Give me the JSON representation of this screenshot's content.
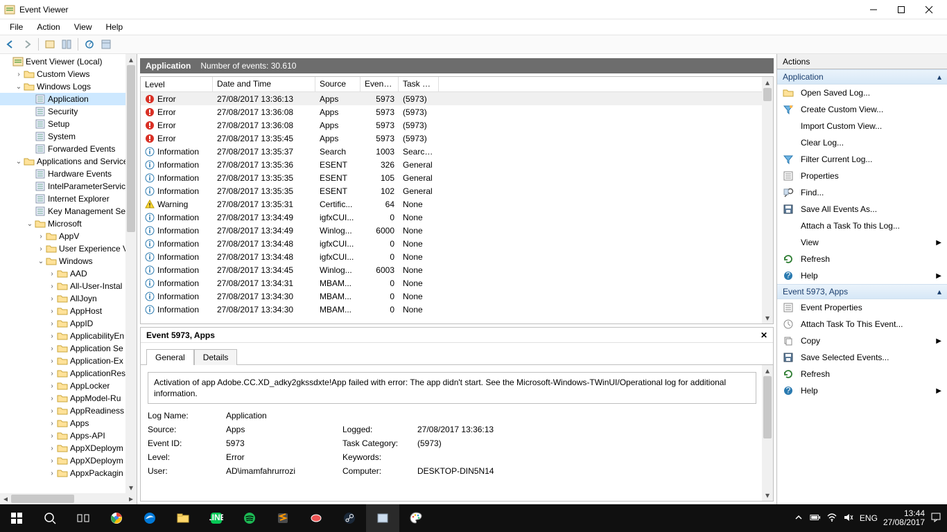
{
  "window": {
    "title": "Event Viewer"
  },
  "menu": [
    "File",
    "Action",
    "View",
    "Help"
  ],
  "tree": [
    {
      "depth": 0,
      "exp": "",
      "icon": "evv",
      "label": "Event Viewer (Local)",
      "sel": false
    },
    {
      "depth": 1,
      "exp": ">",
      "icon": "folder",
      "label": "Custom Views"
    },
    {
      "depth": 1,
      "exp": "v",
      "icon": "folder",
      "label": "Windows Logs"
    },
    {
      "depth": 2,
      "exp": "",
      "icon": "log",
      "label": "Application",
      "sel": true
    },
    {
      "depth": 2,
      "exp": "",
      "icon": "log",
      "label": "Security"
    },
    {
      "depth": 2,
      "exp": "",
      "icon": "log",
      "label": "Setup"
    },
    {
      "depth": 2,
      "exp": "",
      "icon": "log",
      "label": "System"
    },
    {
      "depth": 2,
      "exp": "",
      "icon": "log",
      "label": "Forwarded Events"
    },
    {
      "depth": 1,
      "exp": "v",
      "icon": "folder",
      "label": "Applications and Services"
    },
    {
      "depth": 2,
      "exp": "",
      "icon": "log",
      "label": "Hardware Events"
    },
    {
      "depth": 2,
      "exp": "",
      "icon": "log",
      "label": "IntelParameterService"
    },
    {
      "depth": 2,
      "exp": "",
      "icon": "log",
      "label": "Internet Explorer"
    },
    {
      "depth": 2,
      "exp": "",
      "icon": "log",
      "label": "Key Management Ser"
    },
    {
      "depth": 2,
      "exp": "v",
      "icon": "folder",
      "label": "Microsoft"
    },
    {
      "depth": 3,
      "exp": ">",
      "icon": "folder",
      "label": "AppV"
    },
    {
      "depth": 3,
      "exp": ">",
      "icon": "folder",
      "label": "User Experience Vi"
    },
    {
      "depth": 3,
      "exp": "v",
      "icon": "folder",
      "label": "Windows"
    },
    {
      "depth": 4,
      "exp": ">",
      "icon": "folder",
      "label": "AAD"
    },
    {
      "depth": 4,
      "exp": ">",
      "icon": "folder",
      "label": "All-User-Instal"
    },
    {
      "depth": 4,
      "exp": ">",
      "icon": "folder",
      "label": "AllJoyn"
    },
    {
      "depth": 4,
      "exp": ">",
      "icon": "folder",
      "label": "AppHost"
    },
    {
      "depth": 4,
      "exp": ">",
      "icon": "folder",
      "label": "AppID"
    },
    {
      "depth": 4,
      "exp": ">",
      "icon": "folder",
      "label": "ApplicabilityEn"
    },
    {
      "depth": 4,
      "exp": ">",
      "icon": "folder",
      "label": "Application Se"
    },
    {
      "depth": 4,
      "exp": ">",
      "icon": "folder",
      "label": "Application-Ex"
    },
    {
      "depth": 4,
      "exp": ">",
      "icon": "folder",
      "label": "ApplicationRes"
    },
    {
      "depth": 4,
      "exp": ">",
      "icon": "folder",
      "label": "AppLocker"
    },
    {
      "depth": 4,
      "exp": ">",
      "icon": "folder",
      "label": "AppModel-Ru"
    },
    {
      "depth": 4,
      "exp": ">",
      "icon": "folder",
      "label": "AppReadiness"
    },
    {
      "depth": 4,
      "exp": ">",
      "icon": "folder",
      "label": "Apps"
    },
    {
      "depth": 4,
      "exp": ">",
      "icon": "folder",
      "label": "Apps-API"
    },
    {
      "depth": 4,
      "exp": ">",
      "icon": "folder",
      "label": "AppXDeploym"
    },
    {
      "depth": 4,
      "exp": ">",
      "icon": "folder",
      "label": "AppXDeploym"
    },
    {
      "depth": 4,
      "exp": ">",
      "icon": "folder",
      "label": "AppxPackagin"
    }
  ],
  "center": {
    "head_label": "Application",
    "head_count": "Number of events: 30.610",
    "columns": [
      "Level",
      "Date and Time",
      "Source",
      "Event ID",
      "Task C..."
    ],
    "events": [
      {
        "lvl": "Error",
        "dt": "27/08/2017 13:36:13",
        "src": "Apps",
        "id": "5973",
        "tc": "(5973)",
        "sel": true
      },
      {
        "lvl": "Error",
        "dt": "27/08/2017 13:36:08",
        "src": "Apps",
        "id": "5973",
        "tc": "(5973)"
      },
      {
        "lvl": "Error",
        "dt": "27/08/2017 13:36:08",
        "src": "Apps",
        "id": "5973",
        "tc": "(5973)"
      },
      {
        "lvl": "Error",
        "dt": "27/08/2017 13:35:45",
        "src": "Apps",
        "id": "5973",
        "tc": "(5973)"
      },
      {
        "lvl": "Information",
        "dt": "27/08/2017 13:35:37",
        "src": "Search",
        "id": "1003",
        "tc": "Search ..."
      },
      {
        "lvl": "Information",
        "dt": "27/08/2017 13:35:36",
        "src": "ESENT",
        "id": "326",
        "tc": "General"
      },
      {
        "lvl": "Information",
        "dt": "27/08/2017 13:35:35",
        "src": "ESENT",
        "id": "105",
        "tc": "General"
      },
      {
        "lvl": "Information",
        "dt": "27/08/2017 13:35:35",
        "src": "ESENT",
        "id": "102",
        "tc": "General"
      },
      {
        "lvl": "Warning",
        "dt": "27/08/2017 13:35:31",
        "src": "Certific...",
        "id": "64",
        "tc": "None"
      },
      {
        "lvl": "Information",
        "dt": "27/08/2017 13:34:49",
        "src": "igfxCUI...",
        "id": "0",
        "tc": "None"
      },
      {
        "lvl": "Information",
        "dt": "27/08/2017 13:34:49",
        "src": "Winlog...",
        "id": "6000",
        "tc": "None"
      },
      {
        "lvl": "Information",
        "dt": "27/08/2017 13:34:48",
        "src": "igfxCUI...",
        "id": "0",
        "tc": "None"
      },
      {
        "lvl": "Information",
        "dt": "27/08/2017 13:34:48",
        "src": "igfxCUI...",
        "id": "0",
        "tc": "None"
      },
      {
        "lvl": "Information",
        "dt": "27/08/2017 13:34:45",
        "src": "Winlog...",
        "id": "6003",
        "tc": "None"
      },
      {
        "lvl": "Information",
        "dt": "27/08/2017 13:34:31",
        "src": "MBAM...",
        "id": "0",
        "tc": "None"
      },
      {
        "lvl": "Information",
        "dt": "27/08/2017 13:34:30",
        "src": "MBAM...",
        "id": "0",
        "tc": "None"
      },
      {
        "lvl": "Information",
        "dt": "27/08/2017 13:34:30",
        "src": "MBAM...",
        "id": "0",
        "tc": "None"
      }
    ],
    "details": {
      "title": "Event 5973, Apps",
      "tabs": [
        "General",
        "Details"
      ],
      "message": "Activation of app Adobe.CC.XD_adky2gkssdxte!App failed with error: The app didn't start. See the Microsoft-Windows-TWinUI/Operational log for additional information.",
      "fields": {
        "logname_k": "Log Name:",
        "logname_v": "Application",
        "source_k": "Source:",
        "source_v": "Apps",
        "logged_k": "Logged:",
        "logged_v": "27/08/2017 13:36:13",
        "eventid_k": "Event ID:",
        "eventid_v": "5973",
        "taskcat_k": "Task Category:",
        "taskcat_v": "(5973)",
        "level_k": "Level:",
        "level_v": "Error",
        "keywords_k": "Keywords:",
        "keywords_v": "",
        "user_k": "User:",
        "user_v": "AD\\imamfahrurrozi",
        "computer_k": "Computer:",
        "computer_v": "DESKTOP-DIN5N14"
      }
    }
  },
  "actions": {
    "title": "Actions",
    "section1": "Application",
    "items1": [
      {
        "icon": "open",
        "label": "Open Saved Log..."
      },
      {
        "icon": "filter-new",
        "label": "Create Custom View..."
      },
      {
        "icon": "none",
        "label": "Import Custom View..."
      },
      {
        "icon": "none",
        "label": "Clear Log..."
      },
      {
        "icon": "filter",
        "label": "Filter Current Log..."
      },
      {
        "icon": "props",
        "label": "Properties"
      },
      {
        "icon": "find",
        "label": "Find..."
      },
      {
        "icon": "save",
        "label": "Save All Events As..."
      },
      {
        "icon": "none",
        "label": "Attach a Task To this Log..."
      },
      {
        "icon": "none",
        "label": "View",
        "sub": true
      },
      {
        "icon": "refresh",
        "label": "Refresh"
      },
      {
        "icon": "help",
        "label": "Help",
        "sub": true
      }
    ],
    "section2": "Event 5973, Apps",
    "items2": [
      {
        "icon": "props",
        "label": "Event Properties"
      },
      {
        "icon": "task",
        "label": "Attach Task To This Event..."
      },
      {
        "icon": "copy",
        "label": "Copy",
        "sub": true
      },
      {
        "icon": "save",
        "label": "Save Selected Events..."
      },
      {
        "icon": "refresh",
        "label": "Refresh"
      },
      {
        "icon": "help",
        "label": "Help",
        "sub": true
      }
    ]
  },
  "taskbar": {
    "lang": "ENG",
    "time": "13:44",
    "date": "27/08/2017"
  }
}
